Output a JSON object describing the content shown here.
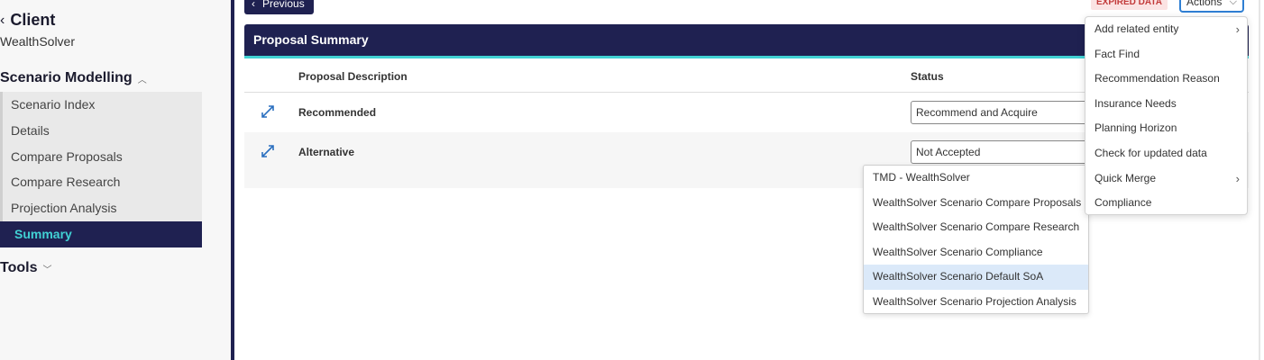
{
  "sidebar": {
    "client_label": "Client",
    "client_name": "WealthSolver",
    "section_scenario": "Scenario Modelling",
    "nav": [
      {
        "label": "Scenario Index"
      },
      {
        "label": "Details"
      },
      {
        "label": "Compare Proposals"
      },
      {
        "label": "Compare Research"
      },
      {
        "label": "Projection Analysis"
      },
      {
        "label": "Summary",
        "active": true
      }
    ],
    "section_tools": "Tools"
  },
  "topbar": {
    "previous_label": "Previous",
    "expired_label": "EXPIRED DATA",
    "actions_label": "Actions"
  },
  "card": {
    "title": "Proposal Summary",
    "col_description": "Proposal Description",
    "col_status": "Status",
    "rows": [
      {
        "description": "Recommended",
        "status": "Recommend and Acquire"
      },
      {
        "description": "Alternative",
        "status": "Not Accepted"
      }
    ]
  },
  "template_dropdown": {
    "options": [
      "TMD - WealthSolver",
      "WealthSolver Scenario Compare Proposals",
      "WealthSolver Scenario Compare Research",
      "WealthSolver Scenario Compliance",
      "WealthSolver Scenario Default SoA",
      "WealthSolver Scenario Projection Analysis"
    ],
    "highlighted": "WealthSolver Scenario Default SoA"
  },
  "actions_menu": {
    "items": [
      {
        "label": "Add related entity",
        "submenu": true
      },
      {
        "label": "Fact Find"
      },
      {
        "label": "Recommendation Reason"
      },
      {
        "label": "Insurance Needs"
      },
      {
        "label": "Planning Horizon"
      },
      {
        "label": "Check for updated data"
      },
      {
        "label": "Quick Merge",
        "submenu": true
      },
      {
        "label": "Compliance"
      }
    ]
  },
  "colors": {
    "navy": "#1f2151",
    "teal": "#41d1d4",
    "expired_bg": "#fbe3e3",
    "expired_text": "#c23a3a",
    "highlight": "#dbe9f9"
  }
}
